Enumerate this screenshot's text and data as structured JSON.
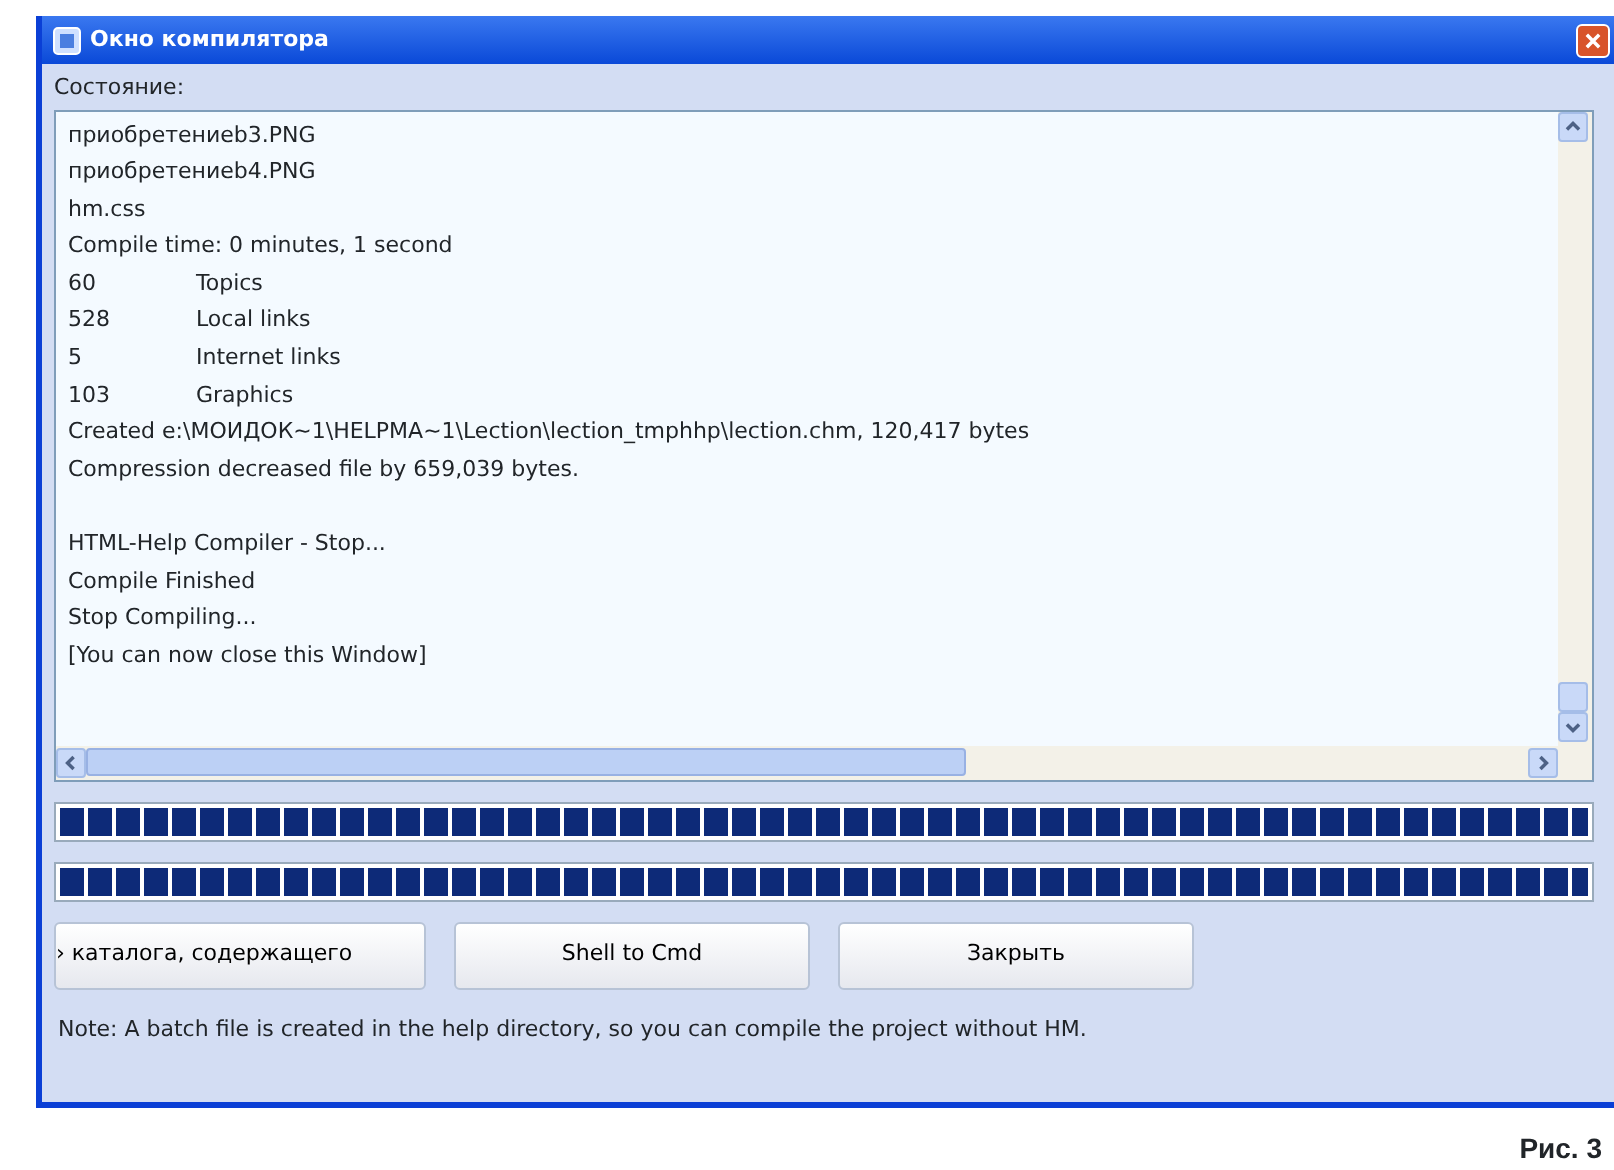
{
  "window": {
    "title": "Окно компилятора"
  },
  "status_label": "Состояние:",
  "log": [
    {
      "kind": "text",
      "text": "приобретениеb3.PNG"
    },
    {
      "kind": "text",
      "text": "приобретениеb4.PNG"
    },
    {
      "kind": "text",
      "text": "hm.css"
    },
    {
      "kind": "text",
      "text": "Compile time: 0 minutes, 1 second"
    },
    {
      "kind": "stat",
      "count": "60",
      "label": "Topics"
    },
    {
      "kind": "stat",
      "count": "528",
      "label": "Local links"
    },
    {
      "kind": "stat",
      "count": "5",
      "label": "Internet links"
    },
    {
      "kind": "stat",
      "count": "103",
      "label": "Graphics"
    },
    {
      "kind": "text",
      "text": "Created e:\\МОИДОК~1\\HELPMA~1\\Lection\\lection_tmphhp\\lection.chm, 120,417 bytes"
    },
    {
      "kind": "text",
      "text": "Compression decreased file by 659,039 bytes."
    },
    {
      "kind": "blank"
    },
    {
      "kind": "text",
      "text": "HTML-Help Compiler - Stop..."
    },
    {
      "kind": "text",
      "text": "Compile Finished"
    },
    {
      "kind": "text",
      "text": "Stop Compiling..."
    },
    {
      "kind": "text",
      "text": "[You can now close this Window]"
    }
  ],
  "progress_bars": [
    {
      "level": 1
    },
    {
      "level": 1
    }
  ],
  "buttons": [
    "› каталога, содержащего",
    "Shell to Cmd",
    "Закрыть"
  ],
  "note": "Note: A batch file is created in the help directory, so you can compile the project without HM.",
  "caption": "Рис. 3"
}
